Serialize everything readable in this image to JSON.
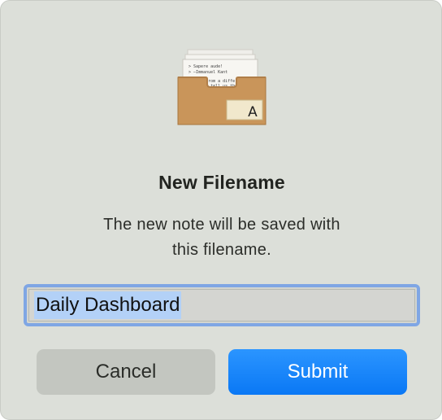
{
  "dialog": {
    "title": "New Filename",
    "message_line1": "The new note will be saved with",
    "message_line2": "this filename.",
    "filename_value": "Daily Dashboard",
    "cancel_label": "Cancel",
    "submit_label": "Submit"
  },
  "icon": {
    "name": "note-archive-box-icon",
    "card_line1": "> Sapere aude!",
    "card_line2": "> —Immanuel Kant",
    "card_line3": "Viewed from a different angle,",
    "card_line4": "...words tell us th...",
    "badge_letter": "A"
  },
  "colors": {
    "accent": "#0a7aff",
    "dialog_bg": "#dcdfd9",
    "selection": "#b3d1f7",
    "focus_ring": "#7fa6e4"
  }
}
